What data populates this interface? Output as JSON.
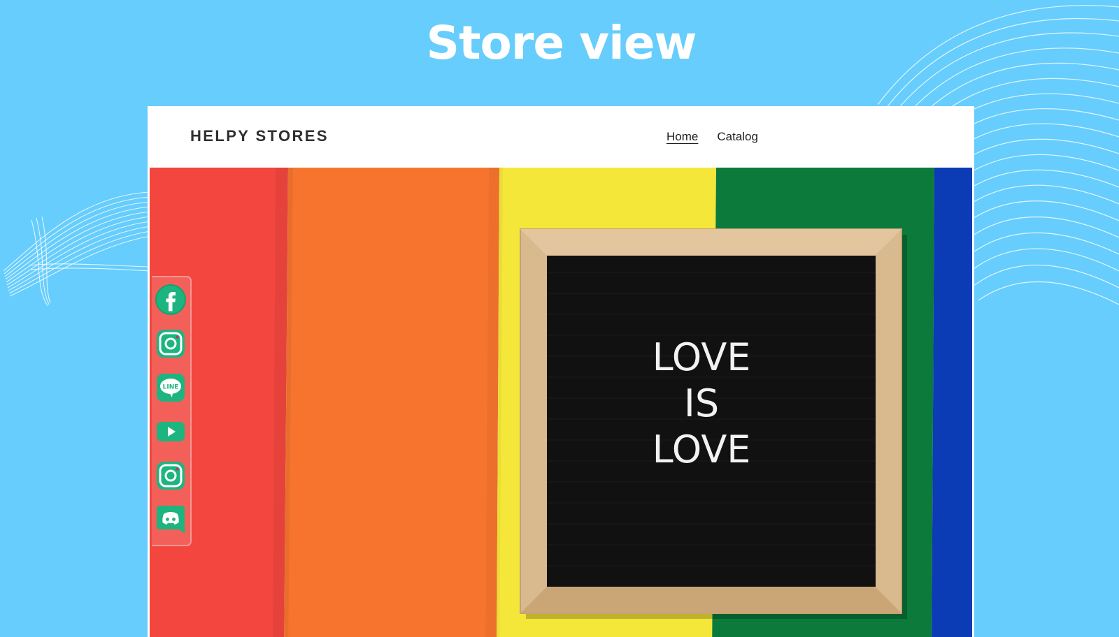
{
  "page": {
    "heading": "Store view"
  },
  "store": {
    "name": "HELPY STORES",
    "nav": [
      {
        "label": "Home",
        "active": true
      },
      {
        "label": "Catalog",
        "active": false
      }
    ]
  },
  "hero": {
    "letter_board_lines": [
      "LOVE",
      "IS",
      "LOVE"
    ]
  },
  "social_links": [
    {
      "icon": "facebook-icon"
    },
    {
      "icon": "instagram-icon"
    },
    {
      "icon": "line-icon",
      "text": "LINE"
    },
    {
      "icon": "youtube-icon"
    },
    {
      "icon": "instagram-icon"
    },
    {
      "icon": "discord-icon"
    }
  ],
  "colors": {
    "background": "#66cdfc",
    "social_accent": "#1db47f",
    "rainbow": [
      "#f2463f",
      "#f7742e",
      "#f5e63a",
      "#0b7a3b",
      "#0b3bb5"
    ]
  }
}
